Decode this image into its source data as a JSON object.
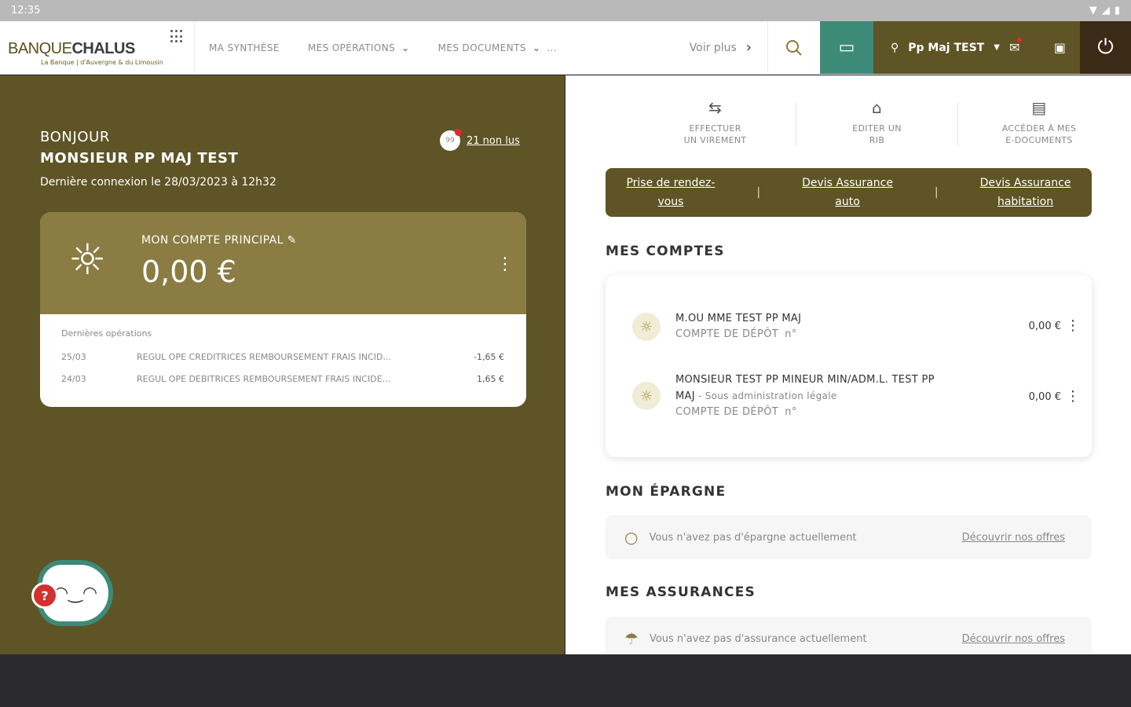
{
  "statusbar": {
    "time": "12:35"
  },
  "brand": {
    "name_part1": "BANQUE",
    "name_part2": "CHALUS",
    "tagline": "La Banque | d'Auvergne & du Limousin"
  },
  "nav": {
    "items": [
      {
        "label": "MA SYNTHÈSE"
      },
      {
        "label": "MES OPÉRATIONS"
      },
      {
        "label": "MES DOCUMENTS"
      }
    ],
    "more": "...",
    "voir_plus": "Voir plus",
    "user_name": "Pp Maj TEST"
  },
  "greeting": {
    "hello": "BONJOUR",
    "name": "MONSIEUR PP MAJ TEST",
    "last_login": "Dernière connexion le 28/03/2023 à 12h32",
    "unread_count": "21 non lus",
    "unread_icon": "99"
  },
  "main_account": {
    "label": "MON COMPTE PRINCIPAL",
    "amount": "0,00 €",
    "ops_title": "Dernières opérations",
    "operations": [
      {
        "date": "25/03",
        "label": "REGUL OPE CREDITRICES REMBOURSEMENT FRAIS INCID...",
        "amount": "-1,65 €"
      },
      {
        "date": "24/03",
        "label": "REGUL OPE DEBITRICES REMBOURSEMENT FRAIS INCIDE...",
        "amount": "1,65 €"
      }
    ]
  },
  "quick_actions": [
    {
      "label_l1": "EFFECTUER",
      "label_l2": "UN VIREMENT",
      "icon": "transfer-icon"
    },
    {
      "label_l1": "EDITER UN",
      "label_l2": "RIB",
      "icon": "rib-icon"
    },
    {
      "label_l1": "ACCÉDER À MES",
      "label_l2": "E-DOCUMENTS",
      "icon": "document-icon"
    }
  ],
  "links": [
    {
      "l1": "Prise de rendez-",
      "l2": "vous"
    },
    {
      "l1": "Devis Assurance",
      "l2": "auto"
    },
    {
      "l1": "Devis Assurance",
      "l2": "habitation"
    }
  ],
  "sections": {
    "accounts": "MES COMPTES",
    "savings": "MON ÉPARGNE",
    "insurance": "MES ASSURANCES"
  },
  "accounts": [
    {
      "holder": "M.OU MME TEST PP MAJ",
      "sub": "",
      "type": "COMPTE DE DÉPÔT",
      "number": "n°",
      "balance": "0,00 €"
    },
    {
      "holder": "MONSIEUR TEST PP MINEUR MIN/ADM.L. TEST PP",
      "holder2": "MAJ",
      "sub": " - Sous administration légale",
      "type": "COMPTE DE DÉPÔT",
      "number": "n°",
      "balance": "0,00 €"
    }
  ],
  "savings": {
    "text": "Vous n'avez pas d'épargne actuellement",
    "link": "Découvrir nos offres"
  },
  "insurance": {
    "text": "Vous n'avez pas d'assurance actuellement",
    "link": "Découvrir nos offres"
  },
  "mascot": {
    "badge": "?"
  },
  "colors": {
    "olive_dark": "#5e5425",
    "olive_light": "#8a7c42",
    "teal": "#3d8a78",
    "brown": "#3b2a16"
  }
}
